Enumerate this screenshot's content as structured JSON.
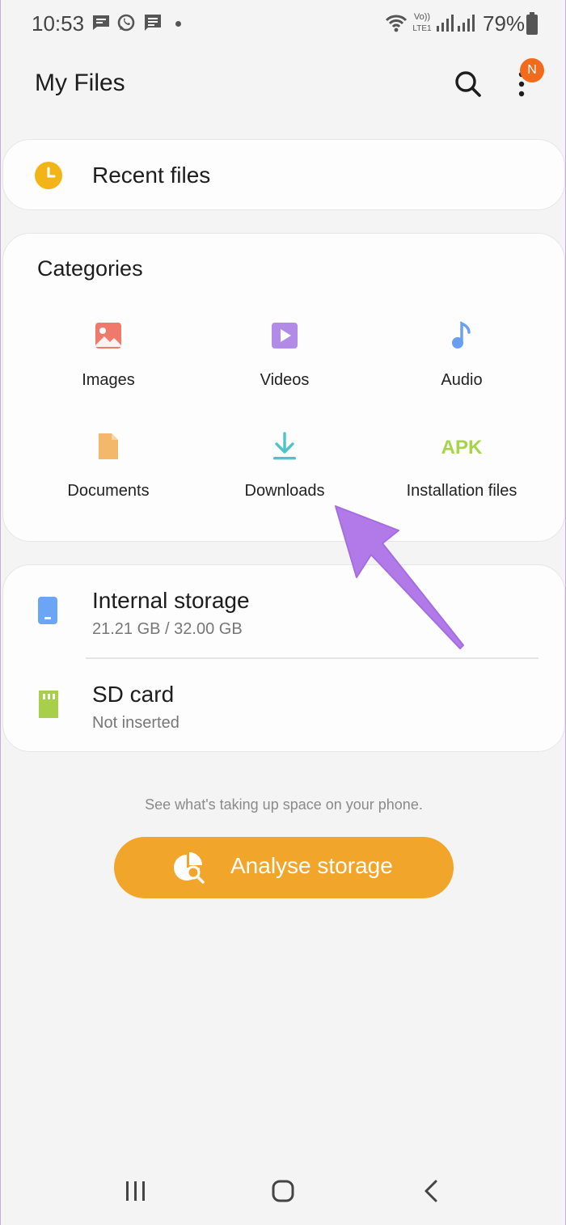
{
  "status_bar": {
    "time": "10:53",
    "battery": "79%",
    "icons": [
      "message-icon",
      "whatsapp-icon",
      "sms-icon",
      "wifi-icon",
      "volte-icon",
      "signal-icon",
      "signal-icon",
      "battery-icon"
    ]
  },
  "header": {
    "title": "My Files",
    "badge": "N"
  },
  "recent": {
    "label": "Recent files",
    "icon": "clock-icon",
    "color": "#f2b417"
  },
  "categories": {
    "title": "Categories",
    "items": [
      {
        "label": "Images",
        "icon": "image-icon",
        "color": "#ef7a6c"
      },
      {
        "label": "Videos",
        "icon": "video-icon",
        "color": "#b28be8"
      },
      {
        "label": "Audio",
        "icon": "audio-icon",
        "color": "#6a9ef2"
      },
      {
        "label": "Documents",
        "icon": "document-icon",
        "color": "#f3b869"
      },
      {
        "label": "Downloads",
        "icon": "download-icon",
        "color": "#4fc3c9"
      },
      {
        "label": "Installation files",
        "icon": "apk-icon",
        "icon_text": "APK",
        "color": "#a8d44a"
      }
    ]
  },
  "storage": {
    "internal": {
      "name": "Internal storage",
      "detail": "21.21 GB / 32.00 GB",
      "icon": "phone-icon",
      "color": "#6aa6f5"
    },
    "sd": {
      "name": "SD card",
      "detail": "Not inserted",
      "icon": "sd-card-icon",
      "color": "#a8cf4a"
    }
  },
  "hint": "See what's taking up space on your phone.",
  "analyse": {
    "label": "Analyse storage",
    "color": "#f2a52b"
  },
  "nav": {
    "recent": "recent-apps-icon",
    "home": "home-icon",
    "back": "back-icon"
  },
  "annotation": {
    "color": "#b27ae8"
  }
}
